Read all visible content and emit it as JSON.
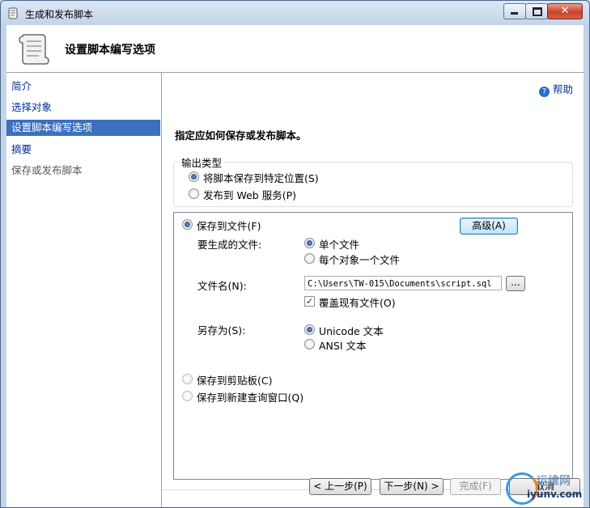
{
  "window": {
    "title": "生成和发布脚本",
    "close_glyph": "✕"
  },
  "header": {
    "title": "设置脚本编写选项"
  },
  "nav": {
    "items": [
      {
        "label": "简介",
        "state": "normal"
      },
      {
        "label": "选择对象",
        "state": "normal"
      },
      {
        "label": "设置脚本编写选项",
        "state": "selected"
      },
      {
        "label": "摘要",
        "state": "normal"
      },
      {
        "label": "保存或发布脚本",
        "state": "disabled"
      }
    ]
  },
  "main": {
    "help": {
      "icon": "help-icon",
      "icon_glyph": "?",
      "label": "帮助"
    },
    "instruction": "指定应如何保存或发布脚本。",
    "output_type": {
      "legend": "输出类型",
      "options": [
        {
          "label": "将脚本保存到特定位置(S)",
          "checked": true
        },
        {
          "label": "发布到 Web 服务(P)",
          "checked": false
        }
      ]
    },
    "save_to_file": {
      "label": "保存到文件(F)",
      "checked": true
    },
    "advanced_button": "高级(A)",
    "files_to_generate": {
      "label": "要生成的文件:",
      "options": [
        {
          "label": "单个文件",
          "checked": true
        },
        {
          "label": "每个对象一个文件",
          "checked": false
        }
      ]
    },
    "file_name": {
      "label": "文件名(N):",
      "value": "C:\\Users\\TW-015\\Documents\\script.sql",
      "browse_label": "..."
    },
    "overwrite": {
      "label": "覆盖现有文件(O)",
      "checked": true,
      "check_glyph": "✓"
    },
    "save_as": {
      "label": "另存为(S):",
      "options": [
        {
          "label": "Unicode 文本",
          "checked": true
        },
        {
          "label": "ANSI 文本",
          "checked": false
        }
      ]
    },
    "save_to_clipboard": {
      "label": "保存到剪贴板(C)",
      "checked": false
    },
    "save_to_query_window": {
      "label": "保存到新建查询窗口(Q)",
      "checked": false
    }
  },
  "footer": {
    "prev_label": "< 上一步(P)",
    "next_label": "下一步(N) >",
    "finish_label": "完成(F)",
    "cancel_label": "取消"
  },
  "watermark": {
    "big": "运维网",
    "small": "iyunv.com"
  },
  "colors": {
    "accent": "#3a70c0",
    "link": "#003399",
    "title_bar": "#c3d4e8"
  }
}
